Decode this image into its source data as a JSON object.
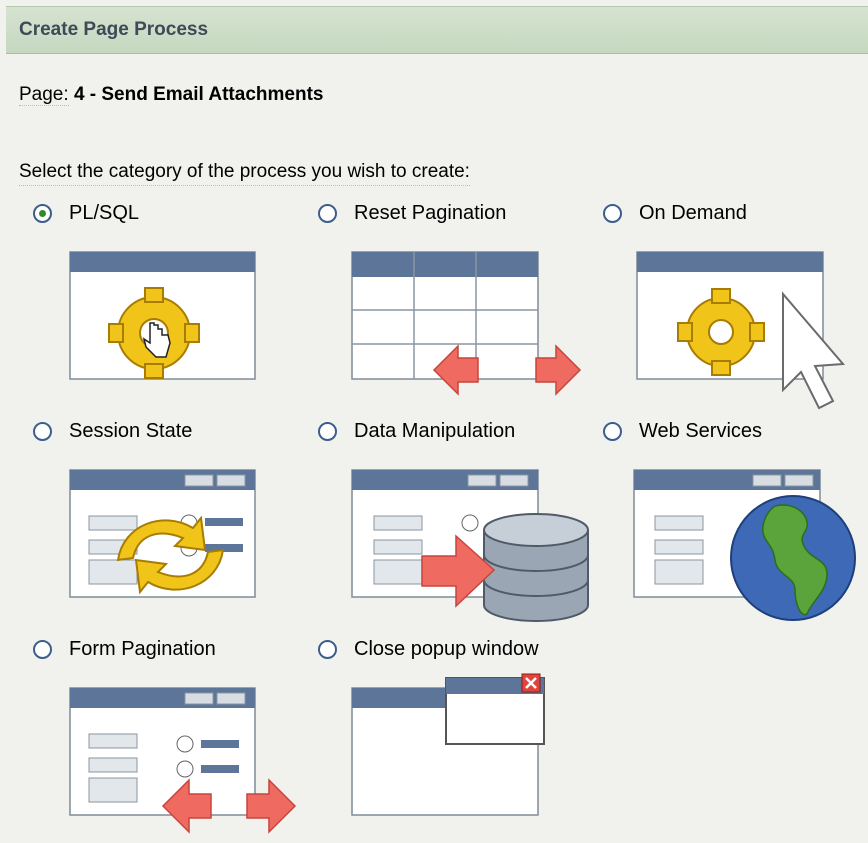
{
  "header": {
    "title": "Create Page Process"
  },
  "page": {
    "label": "Page:",
    "value": "4 - Send Email Attachments"
  },
  "instruction": "Select the category of the process you wish to create:",
  "options": [
    {
      "label": "PL/SQL",
      "selected": true,
      "icon": "gear-hand-icon"
    },
    {
      "label": "Reset Pagination",
      "selected": false,
      "icon": "table-arrows-icon"
    },
    {
      "label": "On Demand",
      "selected": false,
      "icon": "gear-cursor-icon"
    },
    {
      "label": "Session State",
      "selected": false,
      "icon": "refresh-arrows-icon"
    },
    {
      "label": "Data Manipulation",
      "selected": false,
      "icon": "database-icon"
    },
    {
      "label": "Web Services",
      "selected": false,
      "icon": "globe-icon"
    },
    {
      "label": "Form Pagination",
      "selected": false,
      "icon": "form-arrows-icon"
    },
    {
      "label": "Close popup window",
      "selected": false,
      "icon": "popup-close-icon"
    }
  ]
}
